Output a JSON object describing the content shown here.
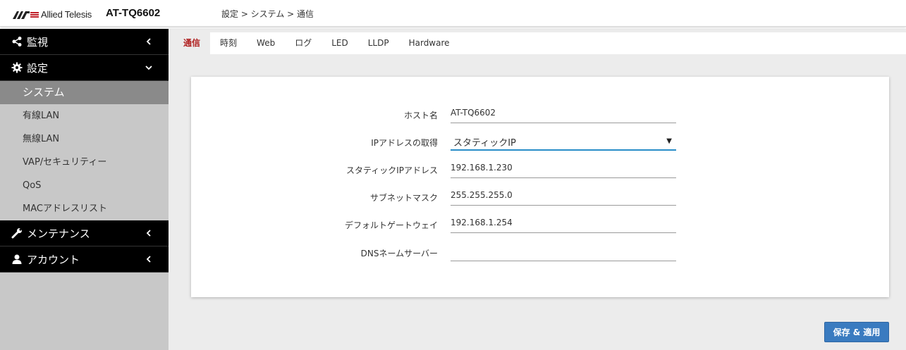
{
  "header": {
    "brand": "Allied Telesis",
    "model": "AT-TQ6602",
    "breadcrumb": "設定 > システム > 通信"
  },
  "sidebar": {
    "monitor": "監視",
    "settings": "設定",
    "items": [
      "システム",
      "有線LAN",
      "無線LAN",
      "VAP/セキュリティー",
      "QoS",
      "MACアドレスリスト"
    ],
    "maintenance": "メンテナンス",
    "account": "アカウント"
  },
  "tabs": [
    "通信",
    "時刻",
    "Web",
    "ログ",
    "LED",
    "LLDP",
    "Hardware"
  ],
  "form": {
    "hostname_label": "ホスト名",
    "hostname_value": "AT-TQ6602",
    "ip_mode_label": "IPアドレスの取得",
    "ip_mode_value": "スタティックIP",
    "static_ip_label": "スタティックIPアドレス",
    "static_ip_value": "192.168.1.230",
    "subnet_label": "サブネットマスク",
    "subnet_value": "255.255.255.0",
    "gateway_label": "デフォルトゲートウェイ",
    "gateway_value": "192.168.1.254",
    "dns_label": "DNSネームサーバー",
    "dns_value": ""
  },
  "actions": {
    "save_apply": "保存 & 適用"
  },
  "colors": {
    "accent": "#3a7bc0",
    "active_tab": "#b02020",
    "sidebar_dark": "#000000",
    "select_underline": "#2a8dc8"
  }
}
